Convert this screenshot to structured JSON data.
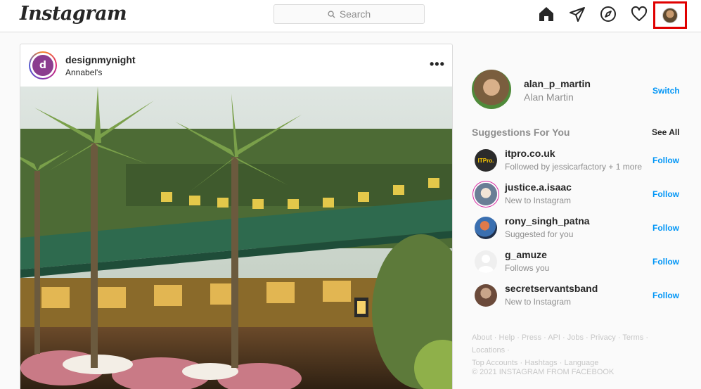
{
  "header": {
    "logo": "Instagram",
    "search_placeholder": "Search"
  },
  "post": {
    "username": "designmynight",
    "avatar_letter": "d",
    "location": "Annabel's",
    "more": "•••"
  },
  "profile": {
    "username": "alan_p_martin",
    "name": "Alan Martin",
    "switch_label": "Switch"
  },
  "suggestions": {
    "title": "Suggestions For You",
    "see_all": "See All",
    "items": [
      {
        "username": "itpro.co.uk",
        "subtitle": "Followed by jessicarfactory + 1 more",
        "action": "Follow",
        "avatar_text": "ITPro."
      },
      {
        "username": "justice.a.isaac",
        "subtitle": "New to Instagram",
        "action": "Follow"
      },
      {
        "username": "rony_singh_patna",
        "subtitle": "Suggested for you",
        "action": "Follow"
      },
      {
        "username": "g_amuze",
        "subtitle": "Follows you",
        "action": "Follow"
      },
      {
        "username": "secretservantsband",
        "subtitle": "New to Instagram",
        "action": "Follow"
      }
    ]
  },
  "footer": {
    "links_line1": "About · Help · Press · API · Jobs · Privacy · Terms · Locations ·",
    "links_line2": "Top Accounts · Hashtags · Language",
    "copyright": "© 2021 INSTAGRAM FROM FACEBOOK"
  },
  "colors": {
    "accent": "#0095f6",
    "highlight_box": "#e00000"
  }
}
